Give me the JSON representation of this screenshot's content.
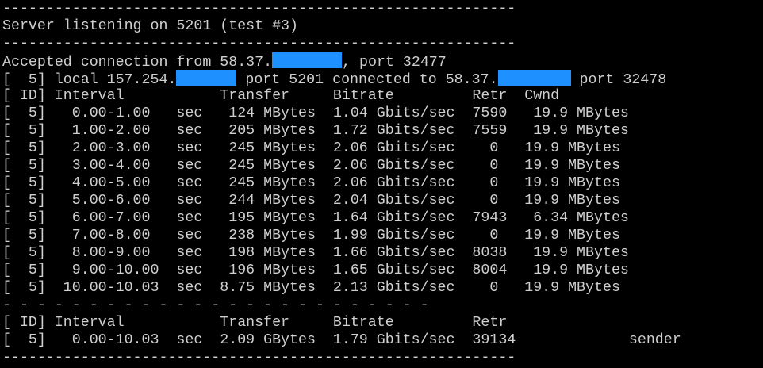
{
  "terminal": {
    "sep_top": "-----------------------------------------------------------",
    "server_listening": "Server listening on 5201 (test #3)",
    "sep_mid": "-----------------------------------------------------------",
    "accepted_prefix": "Accepted connection from 58.37.",
    "accepted_suffix": ", port 32477",
    "conn_prefix": "[  5] local 157.254.",
    "conn_middle": " port 5201 connected to 58.37.",
    "conn_suffix": " port 32478",
    "header": "[ ID] Interval           Transfer     Bitrate         Retr  Cwnd",
    "rows": [
      "[  5]   0.00-1.00   sec   124 MBytes  1.04 Gbits/sec  7590   19.9 MBytes",
      "[  5]   1.00-2.00   sec   205 MBytes  1.72 Gbits/sec  7559   19.9 MBytes",
      "[  5]   2.00-3.00   sec   245 MBytes  2.06 Gbits/sec    0   19.9 MBytes",
      "[  5]   3.00-4.00   sec   245 MBytes  2.06 Gbits/sec    0   19.9 MBytes",
      "[  5]   4.00-5.00   sec   245 MBytes  2.06 Gbits/sec    0   19.9 MBytes",
      "[  5]   5.00-6.00   sec   244 MBytes  2.04 Gbits/sec    0   19.9 MBytes",
      "[  5]   6.00-7.00   sec   195 MBytes  1.64 Gbits/sec  7943   6.34 MBytes",
      "[  5]   7.00-8.00   sec   238 MBytes  1.99 Gbits/sec    0   19.9 MBytes",
      "[  5]   8.00-9.00   sec   198 MBytes  1.66 Gbits/sec  8038   19.9 MBytes",
      "[  5]   9.00-10.00  sec   196 MBytes  1.65 Gbits/sec  8004   19.9 MBytes",
      "[  5]  10.00-10.03  sec  8.75 MBytes  2.13 Gbits/sec    0   19.9 MBytes"
    ],
    "dash_sep": "- - - - - - - - - - - - - - - - - - - - - - - - -",
    "summary_header": "[ ID] Interval           Transfer     Bitrate         Retr",
    "summary_row": "[  5]   0.00-10.03  sec  2.09 GBytes  1.79 Gbits/sec  39134             sender",
    "sep_bottom": "-----------------------------------------------------------"
  },
  "colors": {
    "background": "#000000",
    "text": "#cfcfcf",
    "redaction": "#1e90ff"
  }
}
